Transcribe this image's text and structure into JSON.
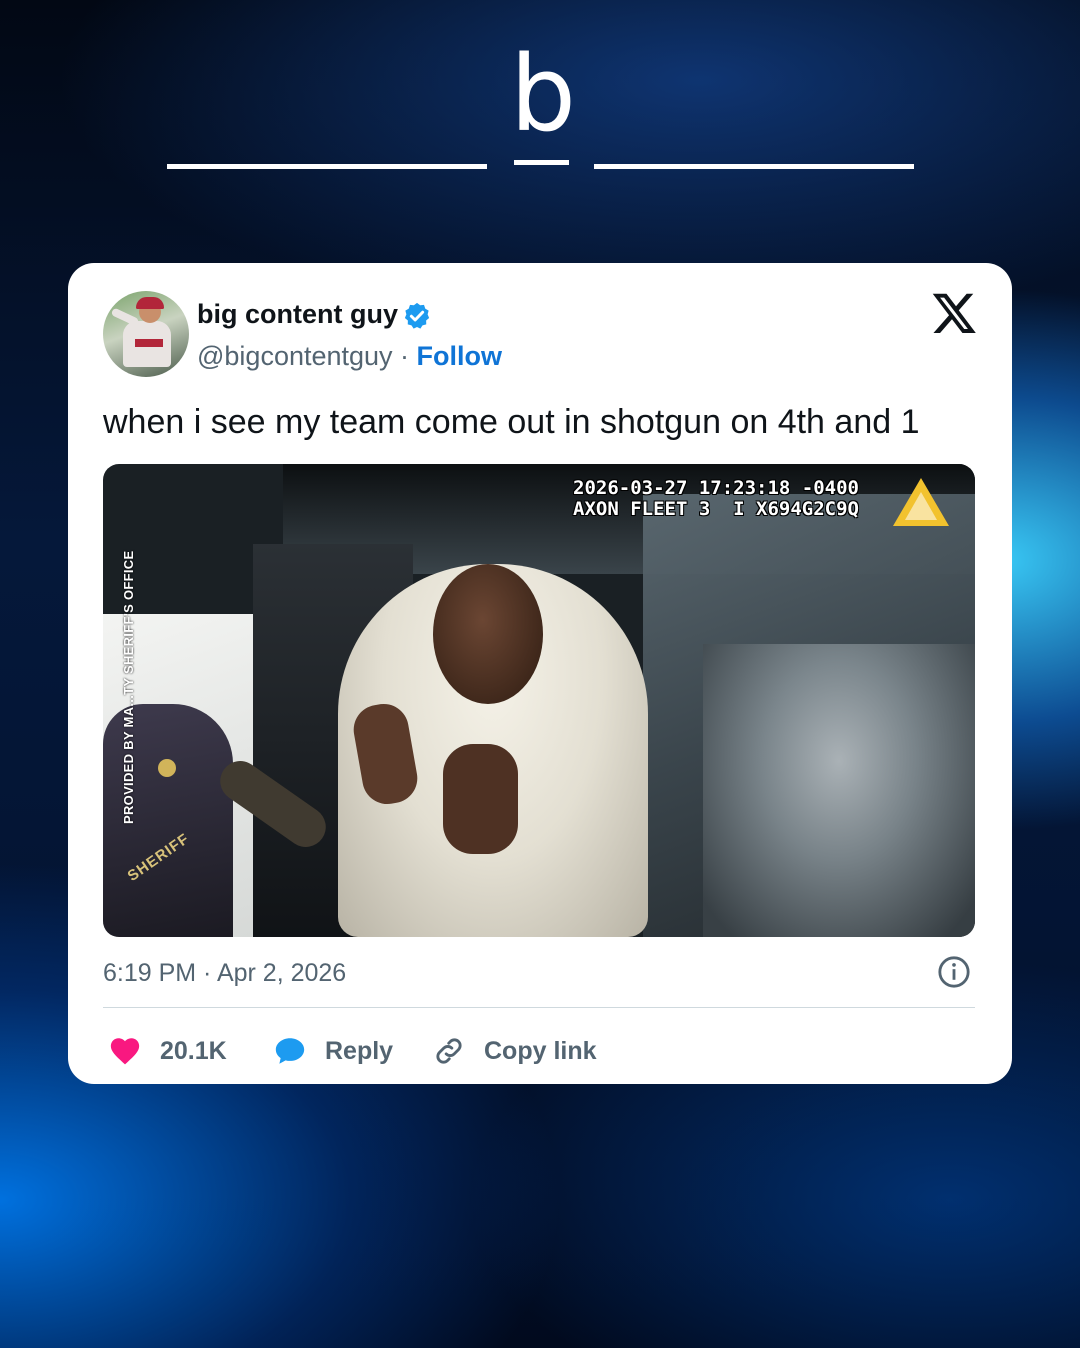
{
  "brand": {
    "letter": "b"
  },
  "tweet": {
    "display_name": "big content guy",
    "handle": "@bigcontentguy",
    "separator": " · ",
    "follow_label": "Follow",
    "text": "when i see my team come out in shotgun on 4th and 1",
    "timestamp": "6:19 PM · Apr 2, 2026",
    "likes": "20.1K",
    "reply_label": "Reply",
    "copy_link_label": "Copy link"
  },
  "media": {
    "camera_overlay": "2026-03-27 17:23:18 -0400\nAXON FLEET 3  I X694G2C9Q",
    "credit_text": "PROVIDED BY MA...TY SHERIFF'S OFFICE",
    "uniform_text": "SHERIFF"
  },
  "icons": {
    "verified": "verified-badge-icon",
    "platform": "x-logo-icon",
    "info": "info-icon",
    "like": "heart-icon",
    "reply": "speech-bubble-icon",
    "copy": "link-icon"
  },
  "colors": {
    "follow": "#0f74d6",
    "heart": "#f91880",
    "reply_bubble": "#1d9bf0",
    "verified": "#1d9bf0",
    "muted_text": "#536471"
  }
}
